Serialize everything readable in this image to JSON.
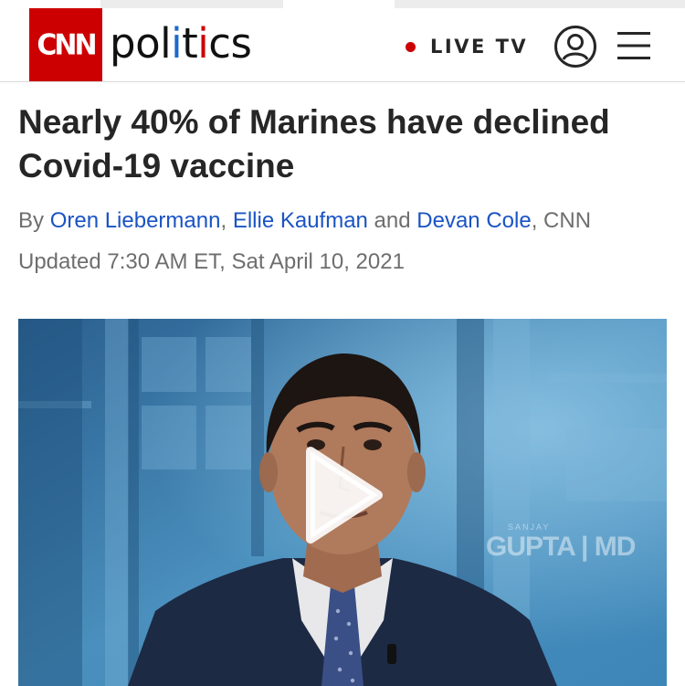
{
  "brand": {
    "logo_text": "CNN",
    "section_prefix": "pol",
    "section_i1": "i",
    "section_mid": "t",
    "section_i2": "i",
    "section_suffix": "cs",
    "accent_color": "#cc0000"
  },
  "nav": {
    "live_label": "LIVE TV",
    "account_icon": "user-circle-icon",
    "menu_icon": "hamburger-menu-icon"
  },
  "article": {
    "headline": "Nearly 40% of Marines have declined Covid-19 vaccine",
    "by_prefix": "By ",
    "authors": [
      "Oren Liebermann",
      "Ellie Kaufman",
      "Devan Cole"
    ],
    "sep1": ", ",
    "sep2": " and ",
    "source_suffix": ", CNN",
    "updated": "Updated 7:30 AM ET, Sat April 10, 2021",
    "link_color": "#1a54c4"
  },
  "video": {
    "play_icon": "play-icon",
    "watermark_small": "SANJAY",
    "watermark_main": "GUPTA | MD"
  }
}
